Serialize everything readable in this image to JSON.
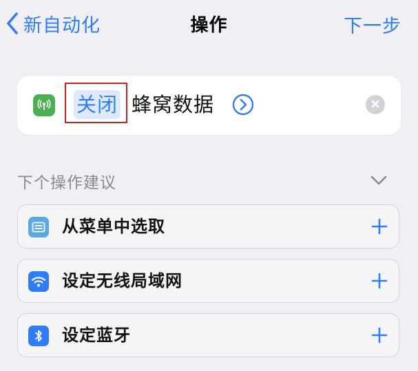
{
  "nav": {
    "back_label": "新自动化",
    "title": "操作",
    "next_label": "下一步"
  },
  "action": {
    "param": "关闭",
    "text": "蜂窝数据"
  },
  "suggestions": {
    "header": "下个操作建议",
    "items": [
      {
        "label": "从菜单中选取",
        "icon": "menu-list-icon",
        "color": "#5AA9E6"
      },
      {
        "label": "设定无线局域网",
        "icon": "wifi-icon",
        "color": "#2F7CF6"
      },
      {
        "label": "设定蓝牙",
        "icon": "bluetooth-icon",
        "color": "#2F7CF6"
      }
    ]
  },
  "colors": {
    "accent": "#2F7CF6",
    "cellular": "#4CAF50",
    "highlight_box": "#C8201F"
  }
}
